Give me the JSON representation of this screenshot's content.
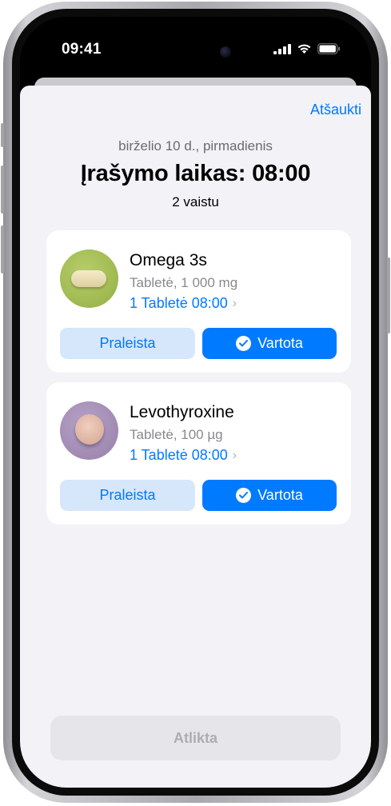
{
  "status_bar": {
    "time": "09:41"
  },
  "sheet": {
    "cancel_label": "Atšaukti",
    "date": "birželio 10 d., pirmadienis",
    "title": "Įrašymo laikas: 08:00",
    "subtitle": "2 vaistu"
  },
  "medications": [
    {
      "name": "Omega 3s",
      "detail": "Tabletė, 1 000 mg",
      "schedule": "1 Tabletė 08:00",
      "skip_label": "Praleista",
      "taken_label": "Vartota",
      "icon": "capsule-icon",
      "icon_bg": "#a4bd55",
      "pill_color": "#ece0b8"
    },
    {
      "name": "Levothyroxine",
      "detail": "Tabletė, 100 µg",
      "schedule": "1 Tabletė 08:00",
      "skip_label": "Praleista",
      "taken_label": "Vartota",
      "icon": "round-pill-icon",
      "icon_bg": "#a58fb7",
      "pill_color": "#e6c0ae"
    }
  ],
  "done_label": "Atlikta",
  "colors": {
    "accent": "#007aff",
    "skip_bg": "#d6e7fb",
    "sheet_bg": "#f2f2f7",
    "disabled_bg": "#e5e5ea",
    "disabled_text": "#adadb2"
  }
}
